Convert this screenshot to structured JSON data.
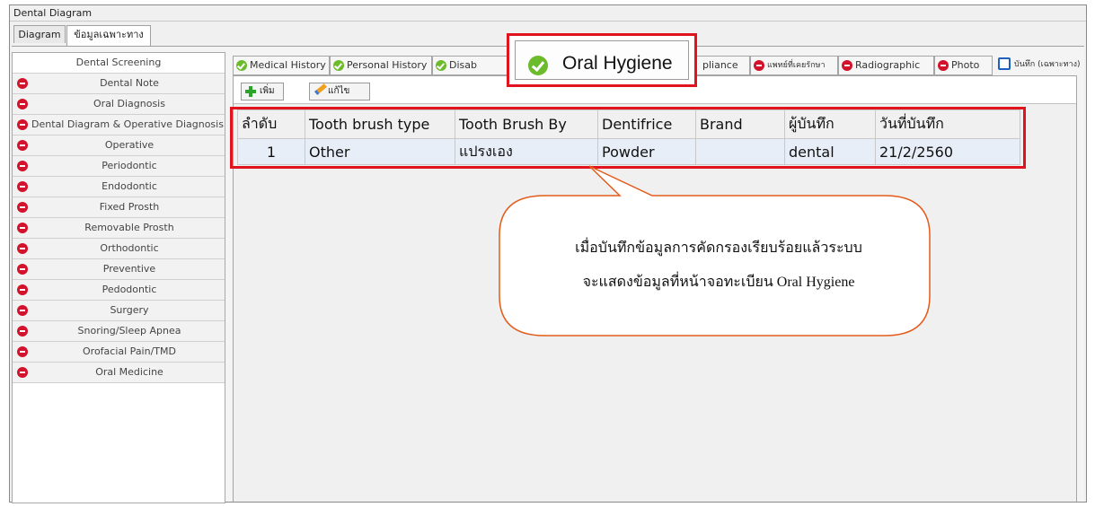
{
  "window": {
    "title": "Dental Diagram"
  },
  "top_tabs": [
    "Diagram",
    "ข้อมูลเฉพาะทาง"
  ],
  "sidebar": {
    "header": "Dental Screening",
    "items": [
      "Dental Note",
      "Oral Diagnosis",
      "Dental Diagram & Operative Diagnosis",
      "Operative",
      "Periodontic",
      "Endodontic",
      "Fixed Prosth",
      "Removable Prosth",
      "Orthodontic",
      "Preventive",
      "Pedodontic",
      "Surgery",
      "Snoring/Sleep Apnea",
      "Orofacial Pain/TMD",
      "Oral Medicine"
    ]
  },
  "subtabs": {
    "medical_history": "Medical History",
    "personal_history": "Personal History",
    "disability": "Disab",
    "appliance": "pliance",
    "treating_doctor": "แพทย์ที่เคยรักษา",
    "radiographic": "Radiographic",
    "photo": "Photo",
    "save_specialty": "บันทึก (เฉพาะทาง)"
  },
  "callout_tab": {
    "label": "Oral Hygiene"
  },
  "toolbar": {
    "add_label": "เพิ่ม",
    "edit_label": "แก้ไข"
  },
  "table": {
    "headers": [
      "ลำดับ",
      "Tooth brush type",
      "Tooth Brush By",
      "Dentifrice",
      "Brand",
      "ผู้บันทึก",
      "วันที่บันทึก"
    ],
    "rows": [
      [
        "1",
        "Other",
        "แปรงเอง",
        "Powder",
        "",
        "dental",
        "21/2/2560"
      ]
    ]
  },
  "callout": {
    "line1": "เมื่อบันทึกข้อมูลการคัดกรองเรียบร้อยแล้วระบบ",
    "line2": "จะแสดงข้อมูลที่หน้าจอทะเบียน Oral Hygiene"
  },
  "colors": {
    "highlight": "#e0141e",
    "callout_border": "#e35b1a",
    "ok": "#6cbb2b",
    "no": "#d3122b"
  }
}
